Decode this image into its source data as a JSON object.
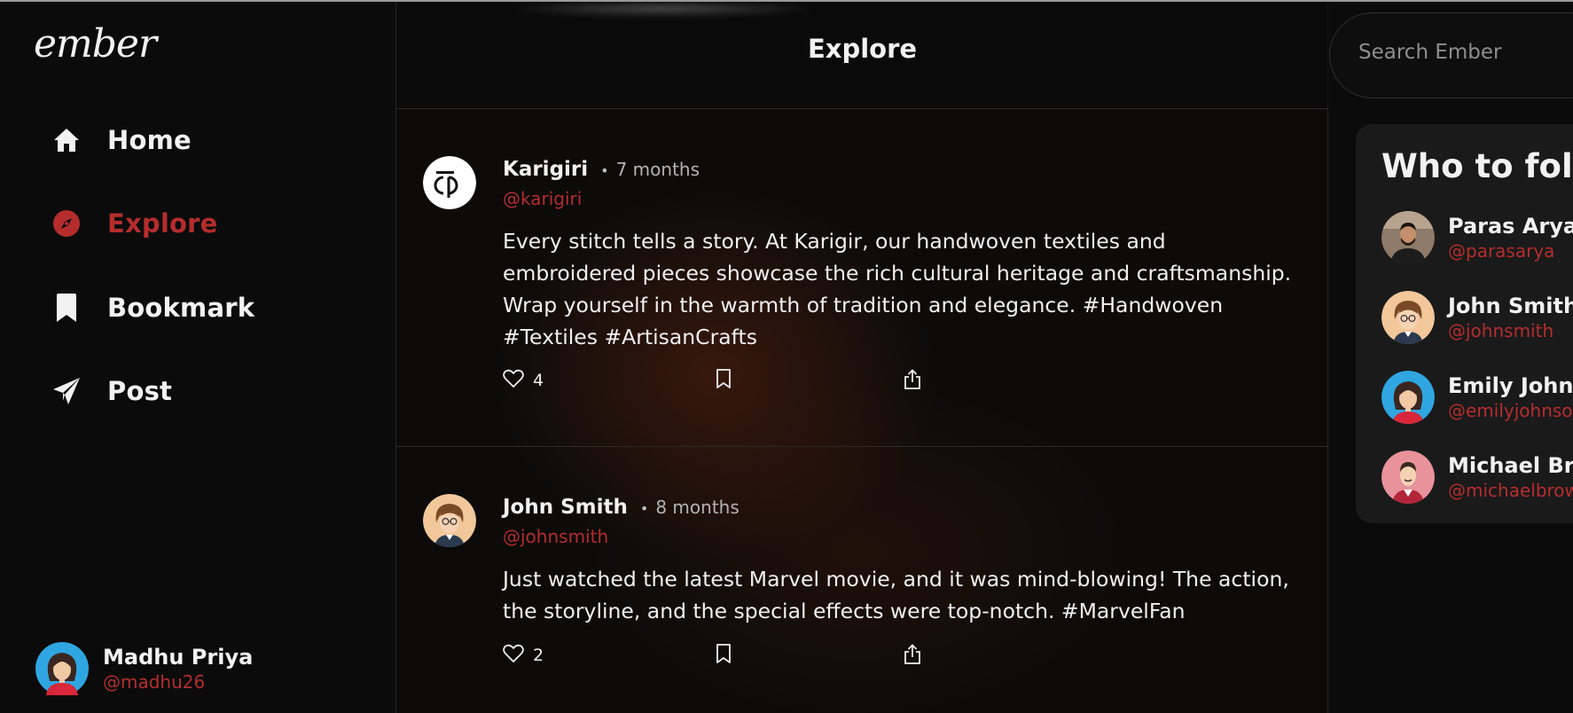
{
  "app": {
    "logo": "ember"
  },
  "nav": {
    "items": [
      {
        "label": "Home",
        "icon": "home-icon"
      },
      {
        "label": "Explore",
        "icon": "compass-icon",
        "active": true
      },
      {
        "label": "Bookmark",
        "icon": "bookmark-icon"
      },
      {
        "label": "Post",
        "icon": "send-icon"
      }
    ]
  },
  "current_user": {
    "name": "Madhu Priya",
    "handle": "@madhu26"
  },
  "feed": {
    "title": "Explore",
    "posts": [
      {
        "author": "Karigiri",
        "time": "7 months",
        "handle": "@karigiri",
        "body": "Every stitch tells a story. At Karigir, our handwoven textiles and embroidered pieces showcase the rich cultural heritage and craftsmanship. Wrap yourself in the warmth of tradition and elegance. #Handwoven #Textiles #ArtisanCrafts",
        "likes": "4"
      },
      {
        "author": "John Smith",
        "time": "8 months",
        "handle": "@johnsmith",
        "body": "Just watched the latest Marvel movie, and it was mind-blowing! The action, the storyline, and the special effects were top-notch. #MarvelFan",
        "likes": "2"
      }
    ]
  },
  "search": {
    "placeholder": "Search Ember"
  },
  "who_to_follow": {
    "title": "Who to follow",
    "users": [
      {
        "name": "Paras Arya",
        "handle": "@parasarya"
      },
      {
        "name": "John Smith",
        "handle": "@johnsmith"
      },
      {
        "name": "Emily Johnson",
        "handle": "@emilyjohnson"
      },
      {
        "name": "Michael Brown",
        "handle": "@michaelbrown"
      }
    ]
  },
  "colors": {
    "accent": "#b52d2d",
    "background": "#0b0b0b",
    "panel": "#1a1a1a",
    "text": "#f2f2f2"
  }
}
